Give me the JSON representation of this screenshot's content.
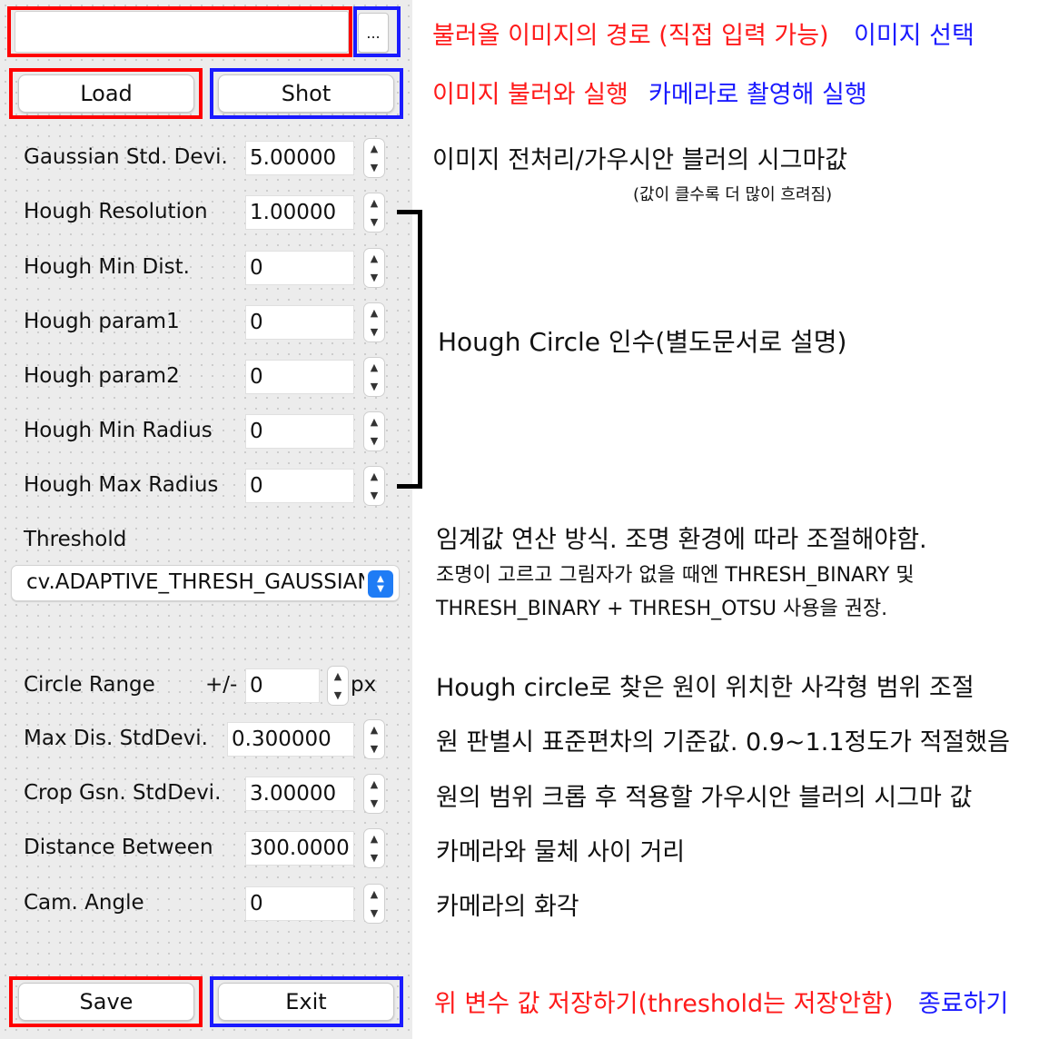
{
  "path_input": {
    "value": ""
  },
  "browse_button": {
    "label": "..."
  },
  "buttons": {
    "load": "Load",
    "shot": "Shot",
    "save": "Save",
    "exit": "Exit"
  },
  "rows": [
    {
      "label": "Gaussian Std. Devi.",
      "value": "5.00000"
    },
    {
      "label": "Hough Resolution",
      "value": "1.00000"
    },
    {
      "label": "Hough Min Dist.",
      "value": "0"
    },
    {
      "label": "Hough param1",
      "value": "0"
    },
    {
      "label": "Hough param2",
      "value": "0"
    },
    {
      "label": "Hough Min Radius",
      "value": "0"
    },
    {
      "label": "Hough Max Radius",
      "value": "0"
    }
  ],
  "threshold": {
    "label": "Threshold",
    "selected": "cv.ADAPTIVE_THRESH_GAUSSIAN_C"
  },
  "circle_range": {
    "label": "Circle Range",
    "prefix": "+/-",
    "value": "0",
    "unit": "px"
  },
  "rows2": [
    {
      "label": "Max Dis. StdDevi.",
      "value": "0.300000"
    },
    {
      "label": "Crop Gsn. StdDevi.",
      "value": "3.00000"
    },
    {
      "label": "Distance Between",
      "value": "300.0000"
    },
    {
      "label": "Cam. Angle",
      "value": "0"
    }
  ],
  "annotations": {
    "path": "불러올 이미지의 경로 (직접 입력 가능)",
    "select_image": "이미지 선택",
    "load_run": "이미지 불러와 실행",
    "shot_run": "카메라로 촬영해 실행",
    "gaussian": "이미지 전처리/가우시안 블러의 시그마값",
    "gaussian_note": "(값이 클수록 더 많이 흐려짐)",
    "hough": "Hough Circle 인수(별도문서로 설명)",
    "threshold_1": "임계값 연산 방식. 조명 환경에 따라 조절해야함.",
    "threshold_2": "조명이 고르고 그림자가 없을 때엔 THRESH_BINARY 및",
    "threshold_3": "THRESH_BINARY + THRESH_OTSU 사용을 권장.",
    "circle_range": "Hough circle로 찾은 원이 위치한 사각형 범위 조절",
    "max_dis": "원 판별시 표준편차의 기준값. 0.9~1.1정도가 적절했음",
    "crop_gsn": "원의 범위 크롭 후 적용할 가우시안 블러의 시그마 값",
    "distance": "카메라와 물체 사이 거리",
    "cam_angle": "카메라의 화각",
    "save": "위 변수 값 저장하기(threshold는 저장안함)",
    "exit": "종료하기"
  },
  "colors": {
    "annotation_red": "#ff1a1a",
    "annotation_blue": "#1a1aff",
    "combo_accent": "#1f7cf5"
  }
}
